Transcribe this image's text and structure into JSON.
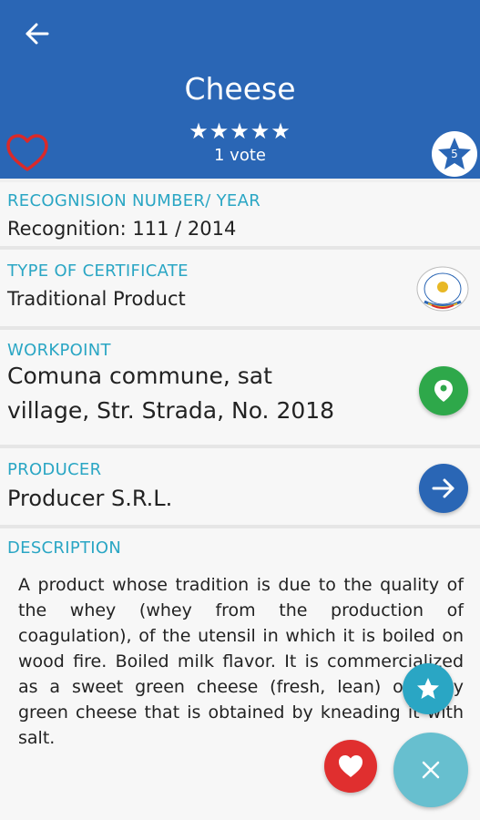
{
  "header": {
    "title": "Cheese",
    "stars": "★★★★★",
    "votes": "1 vote",
    "rating_badge": "5"
  },
  "recognition": {
    "label": "RECOGNISION NUMBER/ YEAR",
    "value": "Recognition: 111  / 2014"
  },
  "certificate": {
    "label": "TYPE OF CERTIFICATE",
    "value": "Traditional Product"
  },
  "workpoint": {
    "label": "WORKPOINT",
    "line1": "Comuna commune, sat",
    "line2": "village, Str. Strada, No. 2018"
  },
  "producer": {
    "label": "PRODUCER",
    "value": "Producer S.R.L."
  },
  "description": {
    "label": "DESCRIPTION",
    "text": "A product whose tradition is due to the quality of the whey (whey from the production of coagulation), of the utensil in which it is boiled on wood fire. Boiled milk flavor. It is commercialized as a sweet green cheese (fresh, lean) or salty green cheese that is obtained by kneading it with salt."
  },
  "colors": {
    "primary": "#2a66b5",
    "accent_label": "#2aa6c4",
    "green": "#2ea84a",
    "red": "#e02f2f",
    "teal_fab": "#67bfcf"
  }
}
